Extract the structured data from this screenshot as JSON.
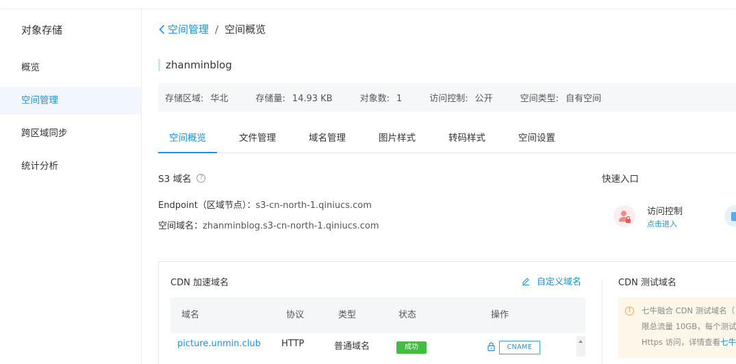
{
  "sidebar": {
    "title": "对象存储",
    "items": [
      {
        "label": "概览",
        "active": false
      },
      {
        "label": "空间管理",
        "active": true
      },
      {
        "label": "跨区域同步",
        "active": false
      },
      {
        "label": "统计分析",
        "active": false
      }
    ]
  },
  "breadcrumb": {
    "parent": "空间管理",
    "separator": "/",
    "current": "空间概览"
  },
  "bucket": {
    "name": "zhanminblog"
  },
  "stats": [
    {
      "label": "存储区域:",
      "value": "华北"
    },
    {
      "label": "存储量:",
      "value": "14.93 KB"
    },
    {
      "label": "对象数:",
      "value": "1"
    },
    {
      "label": "访问控制:",
      "value": "公开"
    },
    {
      "label": "空间类型:",
      "value": "自有空间"
    }
  ],
  "tabs": [
    {
      "label": "空间概览",
      "active": true
    },
    {
      "label": "文件管理",
      "active": false
    },
    {
      "label": "域名管理",
      "active": false
    },
    {
      "label": "图片样式",
      "active": false
    },
    {
      "label": "转码样式",
      "active": false
    },
    {
      "label": "空间设置",
      "active": false
    }
  ],
  "s3": {
    "title": "S3 域名",
    "help": "?",
    "endpoint_label": "Endpoint（区域节点）：",
    "endpoint_value": "s3-cn-north-1.qiniucs.com",
    "domain_label": "空间域名：",
    "domain_value": "zhanminblog.s3-cn-north-1.qiniucs.com"
  },
  "quick": {
    "title": "快速入口",
    "item_name": "访问控制",
    "item_enter": "点击进入"
  },
  "cdn": {
    "title": "CDN 加速域名",
    "custom_domain": "自定义域名",
    "columns": [
      "域名",
      "协议",
      "类型",
      "状态",
      "操作"
    ],
    "rows": [
      {
        "domain": "picture.unmin.club",
        "protocol": "HTTP",
        "type": "普通域名",
        "status": "成功",
        "action": "CNAME"
      }
    ]
  },
  "test_domain": {
    "title": "CDN 测试域名",
    "lines": [
      "七牛融合 CDN 测试域名（",
      "限总流量 10GB，每个测试",
      "Https 访问，详情查看"
    ],
    "link_text": "七牛"
  },
  "colors": {
    "accent": "#1b8fd8",
    "success": "#3fbe3f",
    "warning": "#f2a93b"
  }
}
